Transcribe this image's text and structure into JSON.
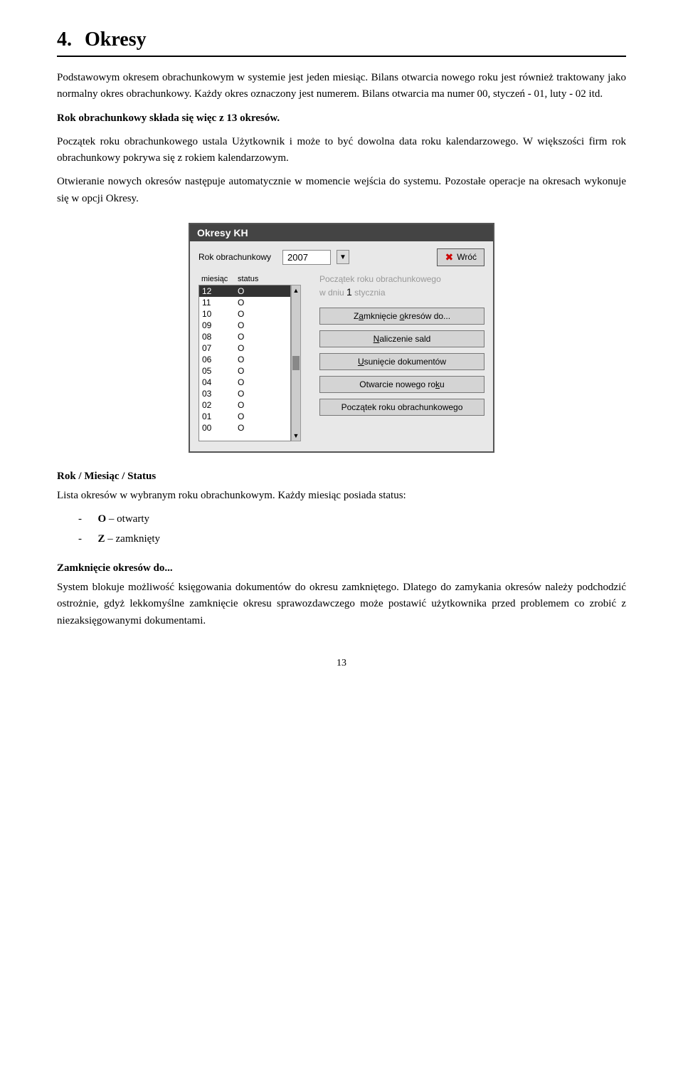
{
  "chapter": {
    "number": "4.",
    "title": "Okresy"
  },
  "paragraphs": [
    "Podstawowym okresem obrachunkowym w systemie jest jeden miesiąc. Bilans otwarcia nowego roku jest również traktowany jako normalny okres obrachunkowy. Każdy okres oznaczony jest numerem. Bilans otwarcia ma numer 00, styczeń - 01, luty - 02 itd.",
    "Rok obrachunkowy składa się więc z 13 okresów.",
    "Początek roku obrachunkowego ustala Użytkownik i może to być dowolna data roku kalendarzowego. W większości firm rok obrachunkowy pokrywa się z rokiem kalendarzowym.",
    "Otwieranie nowych okresów następuje automatycznie w momencie wejścia do systemu. Pozostałe operacje na okresach wykonuje się w opcji Okresy."
  ],
  "dialog": {
    "title": "Okresy KH",
    "rok_label": "Rok obrachunkowy",
    "year_value": "2007",
    "wróć_label": "Wróć",
    "col_miesiac": "miesiąc",
    "col_status": "status",
    "list_rows": [
      {
        "miesiac": "12",
        "status": "O",
        "selected": true
      },
      {
        "miesiac": "11",
        "status": "O",
        "selected": false
      },
      {
        "miesiac": "10",
        "status": "O",
        "selected": false
      },
      {
        "miesiac": "09",
        "status": "O",
        "selected": false
      },
      {
        "miesiac": "08",
        "status": "O",
        "selected": false
      },
      {
        "miesiac": "07",
        "status": "O",
        "selected": false
      },
      {
        "miesiac": "06",
        "status": "O",
        "selected": false
      },
      {
        "miesiac": "05",
        "status": "O",
        "selected": false
      },
      {
        "miesiac": "04",
        "status": "O",
        "selected": false
      },
      {
        "miesiac": "03",
        "status": "O",
        "selected": false
      },
      {
        "miesiac": "02",
        "status": "O",
        "selected": false
      },
      {
        "miesiac": "01",
        "status": "O",
        "selected": false
      },
      {
        "miesiac": "00",
        "status": "O",
        "selected": false
      }
    ],
    "info_text_line1": "Początek roku obrachunkowego",
    "info_text_line2": "w dniu",
    "info_day": "1",
    "info_month": "stycznia",
    "btn_zamkniecie": "Zamknięcie okresów do...",
    "btn_naliczenie": "Naliczenie sald",
    "btn_usuniecie": "Usunięcie dokumentów",
    "btn_otwarcie": "Otwarcie nowego roku",
    "btn_poczatek": "Początek roku obrachunkowego"
  },
  "section2": {
    "heading": "Rok / Miesiąc / Status",
    "text1": "Lista okresów w wybranym roku obrachunkowym. Każdy miesiąc posiada status:",
    "item1_dash": "-",
    "item1_letter": "O",
    "item1_text": "– otwarty",
    "item2_dash": "-",
    "item2_letter": "Z",
    "item2_text": "– zamknięty"
  },
  "section3": {
    "heading": "Zamknięcie okresów do...",
    "text1": "System blokuje możliwość księgowania dokumentów do okresu zamkniętego. Dlatego do zamykania okresów należy podchodzić ostrożnie, gdyż lekkomyślne zamknięcie okresu sprawozdawczego może postawić użytkownika przed problemem co zrobić z niezaksięgowanymi dokumentami."
  },
  "footer": {
    "page_number": "13"
  }
}
